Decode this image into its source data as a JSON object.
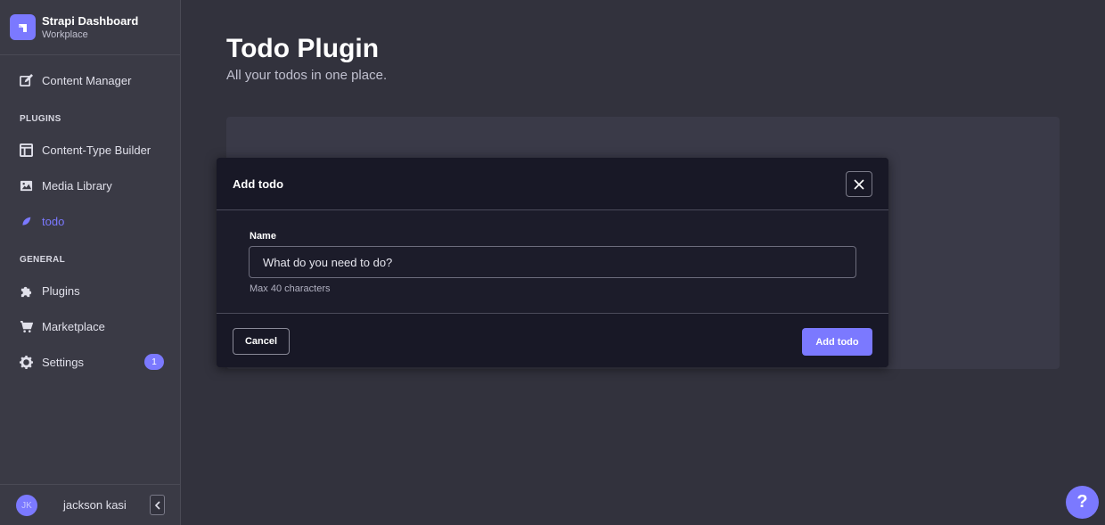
{
  "brand": {
    "title": "Strapi Dashboard",
    "subtitle": "Workplace",
    "logo_icon": "strapi-logo-icon"
  },
  "sidebar": {
    "items": [
      {
        "label": "Content Manager",
        "icon": "pen-icon",
        "active": false
      },
      {
        "label": "Content-Type Builder",
        "icon": "layout-icon",
        "active": false
      },
      {
        "label": "Media Library",
        "icon": "image-icon",
        "active": false
      },
      {
        "label": "todo",
        "icon": "plugin-icon",
        "active": true
      },
      {
        "label": "Plugins",
        "icon": "puzzle-icon",
        "active": false
      },
      {
        "label": "Marketplace",
        "icon": "cart-icon",
        "active": false
      },
      {
        "label": "Settings",
        "icon": "gear-icon",
        "active": false,
        "badge": "1"
      }
    ],
    "sections": {
      "plugins": "PLUGINS",
      "general": "GENERAL"
    }
  },
  "user": {
    "initials": "JK",
    "name": "jackson kasi"
  },
  "main": {
    "title": "Todo Plugin",
    "subtitle": "All your todos in one place."
  },
  "modal": {
    "title": "Add todo",
    "field_label": "Name",
    "field_placeholder": "What do you need to do?",
    "field_hint": "Max 40 characters",
    "cancel_label": "Cancel",
    "submit_label": "Add todo"
  },
  "help_label": "?",
  "colors": {
    "accent": "#7b79ff",
    "sidebar_bg": "#3a3a45",
    "page_bg": "#32323d",
    "modal_bg": "#1c1c2a"
  }
}
